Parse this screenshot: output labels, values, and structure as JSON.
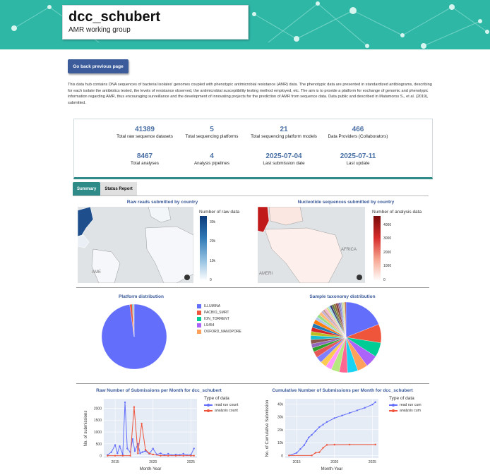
{
  "header": {
    "title": "dcc_schubert",
    "subtitle": "AMR working group"
  },
  "back_button": "Go back previous page",
  "description": "This data hub contains DNA sequences of bacterial isolates' genomes coupled with phenotypic antimicrobial resistance (AMR) data. The phenotypic data are presented in standardized antibiograms, describing for each isolate the antibiotics tested, the levels of resistance observed, the antimicrobial susceptibility testing method employed, etc. The aim is to provide a platform for exchange of genomic and phenotypic information regarding AMR, thus encouraging surveillance and the development of innovating projects for the prediction of AMR from sequence data. Data public and described in Matamoros S., et al. (2019), submitted.",
  "stats": [
    {
      "value": "41389",
      "label": "Total raw sequence datasets"
    },
    {
      "value": "5",
      "label": "Total sequencing platforms"
    },
    {
      "value": "21",
      "label": "Total sequencing platform models"
    },
    {
      "value": "466",
      "label": "Data Providers (Collaborators)"
    },
    {
      "value": "8467",
      "label": "Total analyses"
    },
    {
      "value": "4",
      "label": "Analysis pipelines"
    },
    {
      "value": "2025-07-04",
      "label": "Last submission date"
    },
    {
      "value": "2025-07-11",
      "label": "Last update"
    }
  ],
  "tabs": [
    "Summary",
    "Status Report"
  ],
  "colors": {
    "banner": "#2fb7a6",
    "accent": "#2e8b87",
    "button": "#3b5b9a",
    "value_blue": "#4a6fa5",
    "read_run": "#636efa",
    "analysis": "#ef553b"
  },
  "maps": {
    "raw": {
      "title": "Raw reads submitted by country",
      "legend_title": "Number of raw data",
      "ticks": [
        "30k",
        "20k",
        "10k",
        "0"
      ],
      "labels": [
        "AME"
      ]
    },
    "nucleotide": {
      "title": "Nucleotide sequences submitted by country",
      "legend_title": "Number of analysis data",
      "ticks": [
        "4000",
        "3000",
        "2000",
        "1000",
        "0"
      ],
      "labels": [
        "AFRICA",
        "AMERI"
      ]
    }
  },
  "platform_pie": {
    "title": "Platform distribution",
    "legend": [
      {
        "name": "ILLUMINA",
        "color": "#636efa"
      },
      {
        "name": "PACBIO_SMRT",
        "color": "#ef553b"
      },
      {
        "name": "ION_TORRENT",
        "color": "#00cc96"
      },
      {
        "name": "LS454",
        "color": "#ab63fa"
      },
      {
        "name": "OXFORD_NANOPORE",
        "color": "#ffa15a"
      }
    ]
  },
  "taxonomy_pie": {
    "title": "Sample taxonomy distribution"
  },
  "chart_data": [
    {
      "type": "pie",
      "title": "Platform distribution",
      "labels": [
        "ILLUMINA",
        "PACBIO_SMRT",
        "ION_TORRENT",
        "LS454",
        "OXFORD_NANOPORE"
      ],
      "values": [
        97.8,
        1.2,
        0.4,
        0.3,
        0.3
      ]
    },
    {
      "type": "pie",
      "title": "Sample taxonomy distribution",
      "values": [
        20,
        9,
        7,
        6,
        5,
        5,
        4,
        4,
        3,
        3,
        3,
        3,
        2,
        2,
        2,
        2,
        2,
        2,
        2,
        2,
        1.5,
        1.5,
        1.5,
        1,
        1,
        1,
        1,
        1,
        1,
        1,
        1,
        1,
        0.5,
        0.5,
        0.5,
        0.5,
        0.5,
        0.5,
        0.5,
        0.5
      ]
    },
    {
      "type": "line",
      "title": "Raw Number of Submissions per Month for dcc_schubert",
      "xlabel": "Month-Year",
      "ylabel": "No. of submissions",
      "legend_title": "Type of data",
      "xticks": [
        "2015",
        "2020",
        "2025"
      ],
      "yticks": [
        "0",
        "500",
        "1000",
        "1500",
        "2000"
      ],
      "xlim": [
        2013.5,
        2025.8
      ],
      "ylim": [
        -100,
        2400
      ],
      "series": [
        {
          "name": "read run count",
          "x": [
            2014.0,
            2014.5,
            2015.0,
            2015.3,
            2015.6,
            2016.0,
            2016.3,
            2016.6,
            2017.0,
            2017.3,
            2017.6,
            2018.0,
            2018.3,
            2018.6,
            2019.0,
            2019.5,
            2020.0,
            2020.5,
            2021.0,
            2021.5,
            2022.0,
            2022.5,
            2023.0,
            2023.5,
            2024.0,
            2024.5,
            2025.0,
            2025.4
          ],
          "y": [
            30,
            150,
            450,
            100,
            400,
            50,
            2250,
            300,
            150,
            700,
            200,
            500,
            100,
            150,
            200,
            80,
            300,
            50,
            100,
            30,
            80,
            20,
            50,
            30,
            80,
            20,
            40,
            300
          ]
        },
        {
          "name": "analysis count",
          "x": [
            2014.0,
            2015.0,
            2016.0,
            2017.0,
            2017.5,
            2018.0,
            2018.5,
            2019.0,
            2019.5,
            2020.0,
            2021.0,
            2022.0,
            2023.0,
            2024.0,
            2025.0,
            2025.4
          ],
          "y": [
            0,
            0,
            0,
            0,
            2050,
            100,
            1350,
            250,
            100,
            50,
            0,
            0,
            0,
            0,
            0,
            0
          ]
        }
      ]
    },
    {
      "type": "line",
      "title": "Cumulative Number of Submissions per Month for dcc_schubert",
      "xlabel": "Month-Year",
      "ylabel": "No. of Cumulative Submission",
      "legend_title": "Type of data",
      "xticks": [
        "2015",
        "2020",
        "2025"
      ],
      "yticks": [
        "0",
        "10k",
        "20k",
        "30k",
        "40k"
      ],
      "xlim": [
        2013.5,
        2025.8
      ],
      "ylim": [
        -2000,
        44000
      ],
      "series": [
        {
          "name": "read run cum",
          "x": [
            2014.0,
            2015.0,
            2015.5,
            2016.0,
            2016.3,
            2016.6,
            2017.0,
            2017.5,
            2018.0,
            2018.5,
            2019.0,
            2020.0,
            2021.0,
            2022.0,
            2023.0,
            2024.0,
            2025.0,
            2025.4
          ],
          "y": [
            0,
            2000,
            5000,
            8000,
            11000,
            14000,
            16000,
            19000,
            22000,
            24000,
            26000,
            29000,
            31000,
            33000,
            35000,
            37000,
            39500,
            41389
          ]
        },
        {
          "name": "analysis cum",
          "x": [
            2014.0,
            2017.0,
            2017.5,
            2018.0,
            2018.5,
            2019.0,
            2020.0,
            2022.0,
            2025.4
          ],
          "y": [
            0,
            0,
            2100,
            2500,
            6000,
            8200,
            8400,
            8450,
            8467
          ]
        }
      ]
    }
  ]
}
